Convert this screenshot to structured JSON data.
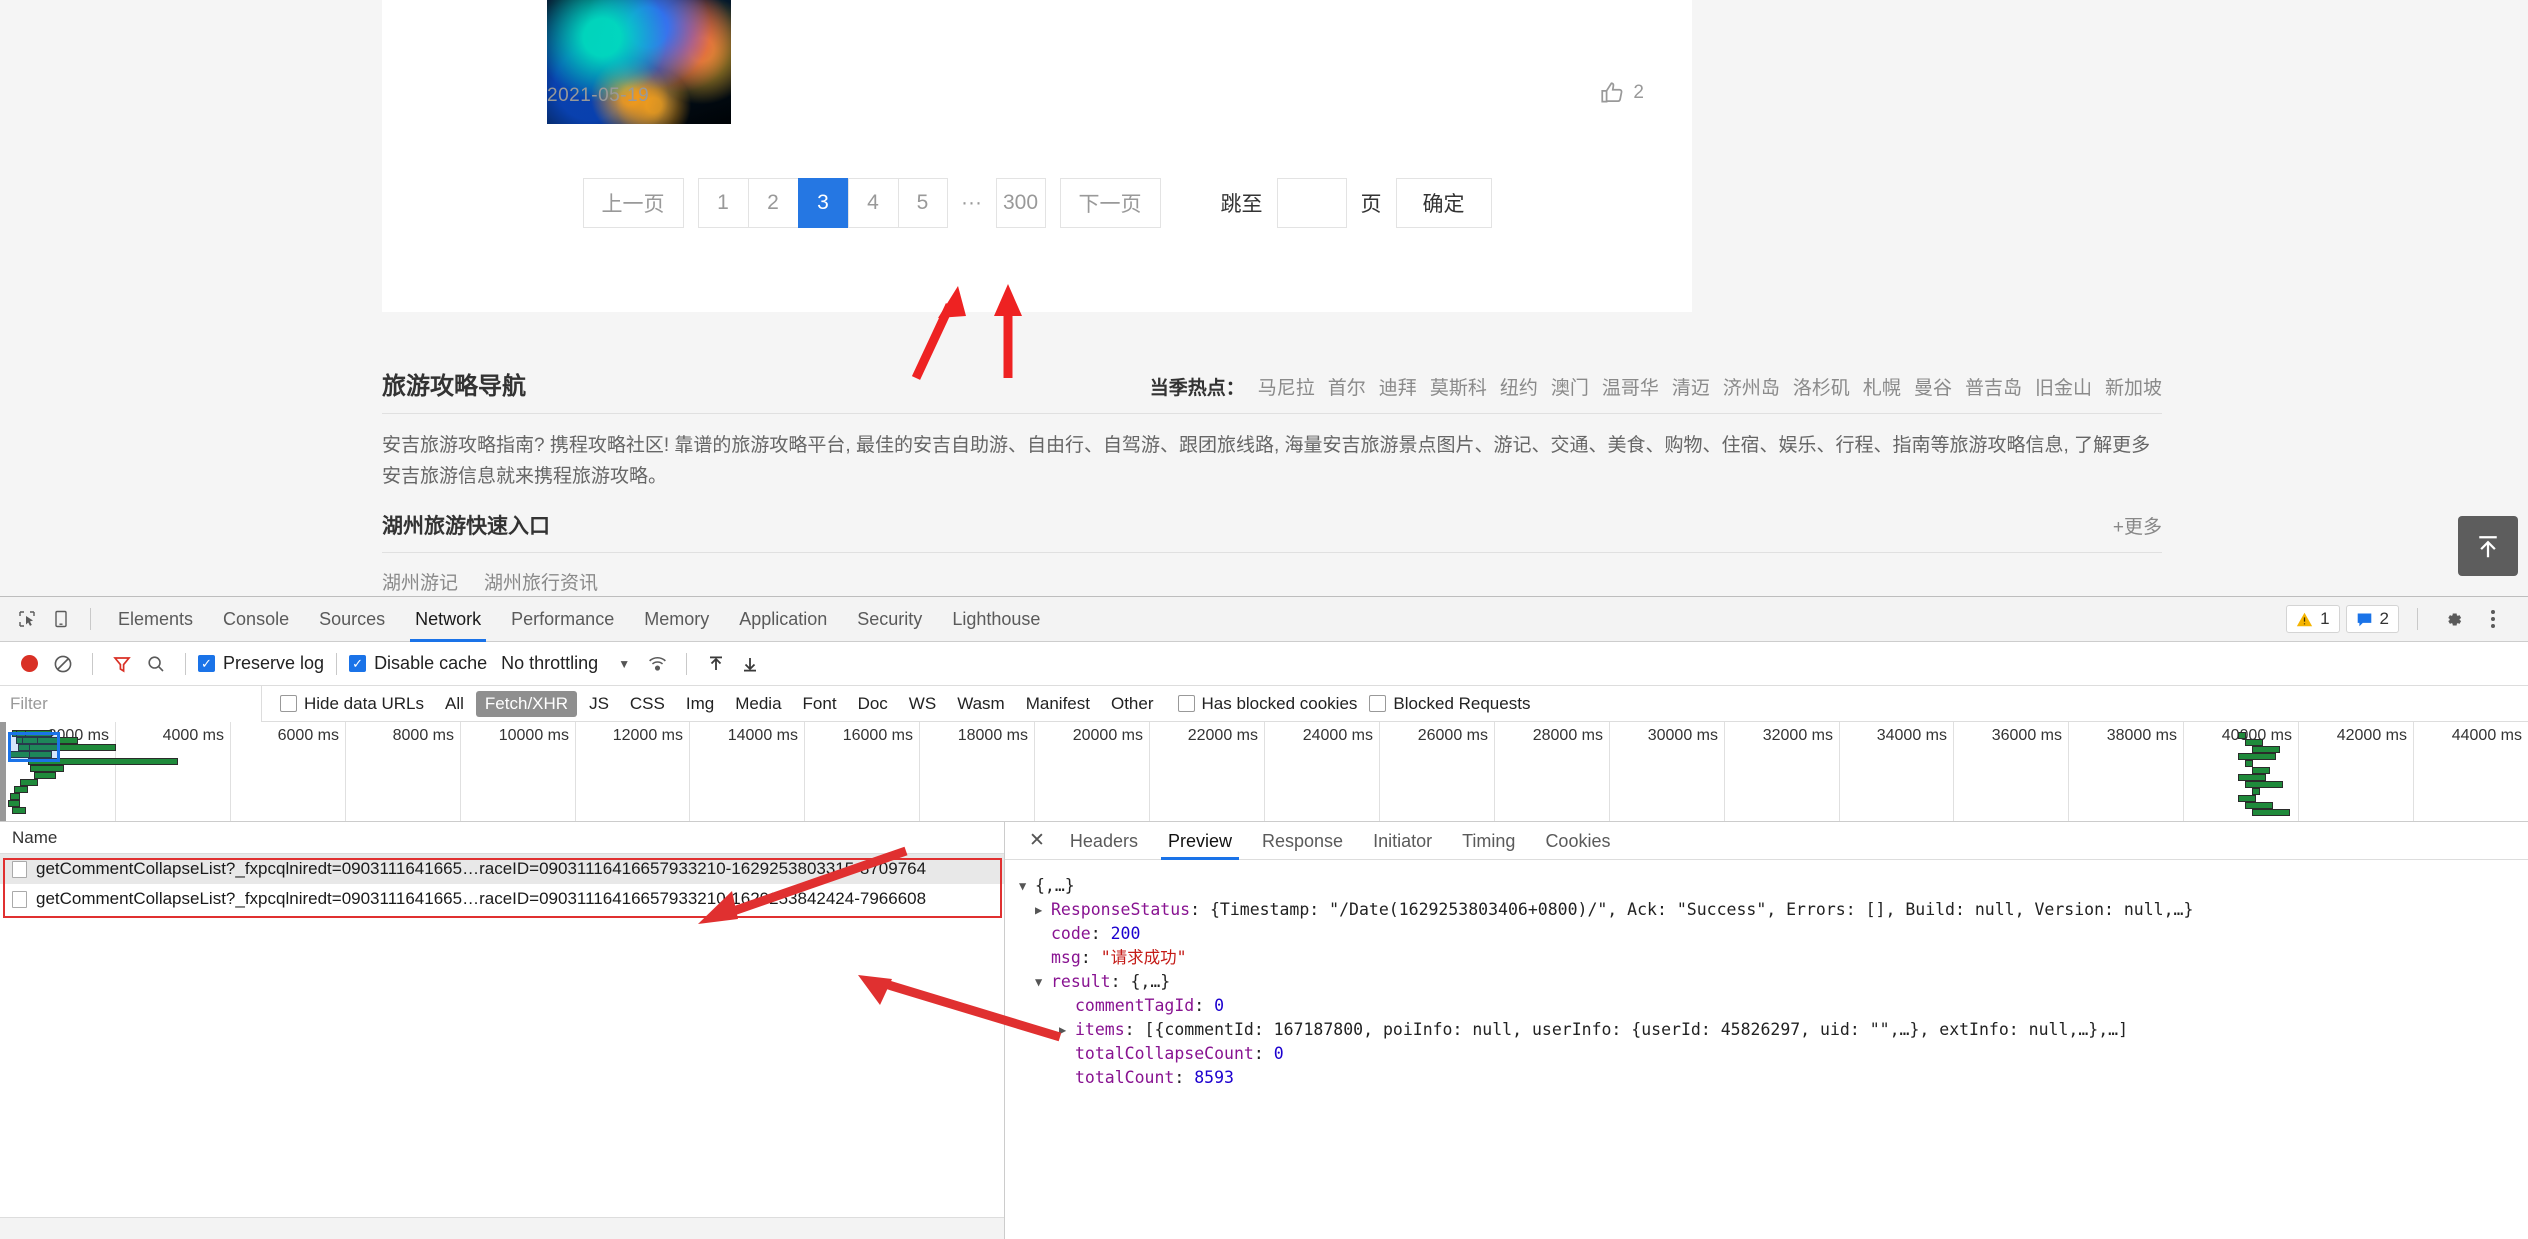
{
  "page": {
    "post_date": "2021-05-19",
    "like_count": "2",
    "pagination": {
      "prev_label": "上一页",
      "pages": [
        "1",
        "2",
        "3",
        "4",
        "5"
      ],
      "active_page": "3",
      "ellipsis": "···",
      "last_page": "300",
      "next_label": "下一页",
      "jump_label": "跳至",
      "jump_value": "",
      "jump_placeholder": "",
      "page_unit": "页",
      "confirm_label": "确定"
    },
    "guide": {
      "title": "旅游攻略导航",
      "hot_label": "当季热点：",
      "hot_cities": [
        "马尼拉",
        "首尔",
        "迪拜",
        "莫斯科",
        "纽约",
        "澳门",
        "温哥华",
        "清迈",
        "济州岛",
        "洛杉矶",
        "札幌",
        "曼谷",
        "普吉岛",
        "旧金山",
        "新加坡"
      ],
      "description": "安吉旅游攻略指南? 携程攻略社区! 靠谱的旅游攻略平台, 最佳的安吉自助游、自由行、自驾游、跟团旅线路, 海量安吉旅游景点图片、游记、交通、美食、购物、住宿、娱乐、行程、指南等旅游攻略信息, 了解更多安吉旅游信息就来携程旅游攻略。"
    },
    "quick": {
      "title": "湖州旅游快速入口",
      "more_label": "+更多",
      "links": [
        "湖州游记",
        "湖州旅行资讯"
      ]
    },
    "backtop_icon": "scroll-to-top-icon"
  },
  "devtools": {
    "tabs": [
      "Elements",
      "Console",
      "Sources",
      "Network",
      "Performance",
      "Memory",
      "Application",
      "Security",
      "Lighthouse"
    ],
    "active_tab": "Network",
    "inspect_icon": "inspect-element-icon",
    "device_icon": "device-toolbar-icon",
    "warning_count": "1",
    "message_count": "2",
    "settings_icon": "gear-icon",
    "more_icon": "kebab-menu-icon",
    "network_bar": {
      "record_icon": "record-icon",
      "clear_icon": "clear-icon",
      "filter_icon": "filter-icon",
      "search_icon": "search-icon",
      "preserve_log_label": "Preserve log",
      "preserve_log_checked": true,
      "disable_cache_label": "Disable cache",
      "disable_cache_checked": true,
      "throttling_value": "No throttling",
      "wifi_icon": "network-conditions-icon",
      "import_icon": "import-har-icon",
      "export_icon": "export-har-icon"
    },
    "filter_bar": {
      "filter_placeholder": "Filter",
      "filter_value": "",
      "hide_data_urls_label": "Hide data URLs",
      "types": [
        "All",
        "Fetch/XHR",
        "JS",
        "CSS",
        "Img",
        "Media",
        "Font",
        "Doc",
        "WS",
        "Wasm",
        "Manifest",
        "Other"
      ],
      "active_type": "Fetch/XHR",
      "has_blocked_cookies_label": "Has blocked cookies",
      "blocked_requests_label": "Blocked Requests"
    },
    "timeline": {
      "ticks": [
        "2000 ms",
        "4000 ms",
        "6000 ms",
        "8000 ms",
        "10000 ms",
        "12000 ms",
        "14000 ms",
        "16000 ms",
        "18000 ms",
        "20000 ms",
        "22000 ms",
        "24000 ms",
        "26000 ms",
        "28000 ms",
        "30000 ms",
        "32000 ms",
        "34000 ms",
        "36000 ms",
        "38000 ms",
        "40000 ms",
        "42000 ms",
        "44000 ms"
      ]
    },
    "requests": {
      "column_name": "Name",
      "rows": [
        {
          "name": "getCommentCollapseList?_fxpcqlniredt=0903111641665…raceID=09031116416657933210-1629253803315-8709764",
          "selected": true
        },
        {
          "name": "getCommentCollapseList?_fxpcqlniredt=0903111641665…raceID=09031116416657933210-1629253842424-7966608",
          "selected": false
        }
      ]
    },
    "detail": {
      "close_icon": "close-icon",
      "tabs": [
        "Headers",
        "Preview",
        "Response",
        "Initiator",
        "Timing",
        "Cookies"
      ],
      "active_tab": "Preview",
      "json": {
        "root": "{,…}",
        "response_status_key": "ResponseStatus",
        "response_status_value": "{Timestamp: \"/Date(1629253803406+0800)/\", Ack: \"Success\", Errors: [], Build: null, Version: null,…}",
        "code_key": "code",
        "code_value": "200",
        "msg_key": "msg",
        "msg_value": "\"请求成功\"",
        "result_key": "result",
        "result_value": "{,…}",
        "comment_tag_id_key": "commentTagId",
        "comment_tag_id_value": "0",
        "items_key": "items",
        "items_value": "[{commentId: 167187800, poiInfo: null, userInfo: {userId: 45826297, uid: \"\",…}, extInfo: null,…},…]",
        "total_collapse_key": "totalCollapseCount",
        "total_collapse_value": "0",
        "total_count_key": "totalCount",
        "total_count_value": "8593"
      }
    }
  }
}
